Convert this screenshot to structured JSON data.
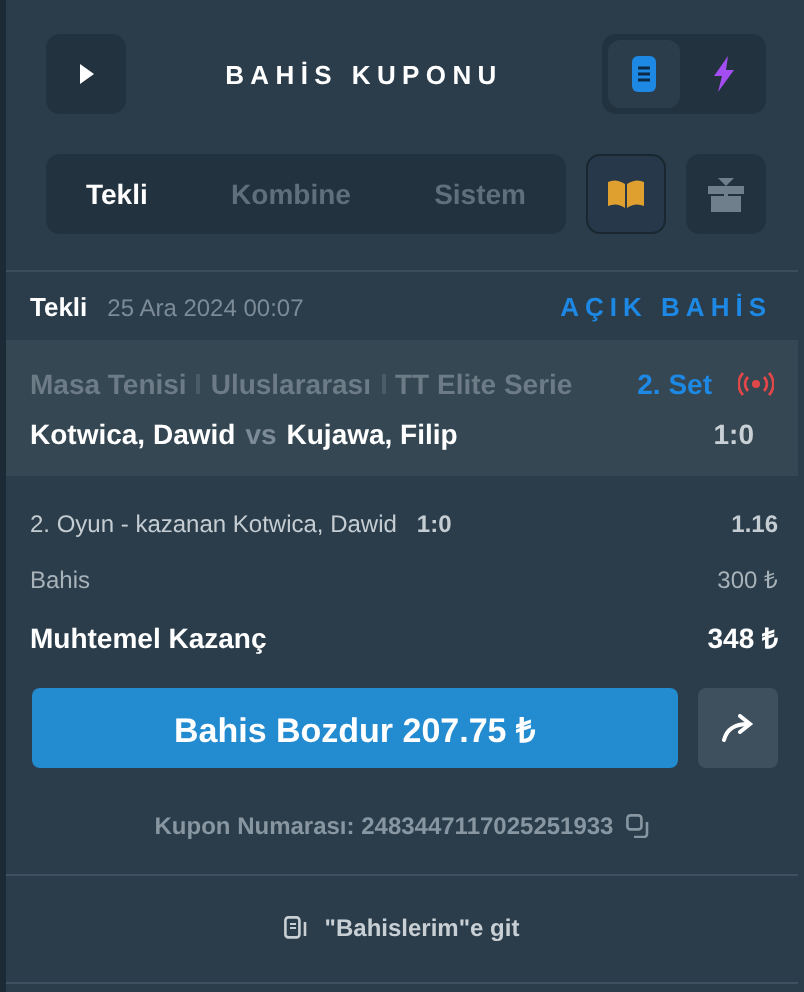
{
  "title": "BAHİS KUPONU",
  "modes": [
    {
      "kind": "document",
      "selected": true
    },
    {
      "kind": "bolt",
      "selected": false
    }
  ],
  "tabs": [
    {
      "label": "Tekli",
      "selected": true
    },
    {
      "label": "Kombine",
      "selected": false
    },
    {
      "label": "Sistem",
      "selected": false
    }
  ],
  "tools": [
    {
      "kind": "book",
      "selected": true
    },
    {
      "kind": "gift",
      "selected": false
    }
  ],
  "ticket": {
    "type": "Tekli",
    "date": "25 Ara 2024 00:07",
    "status": "AÇIK BAHİS",
    "breadcrumb": [
      "Masa Tenisi",
      "Uluslararası",
      "TT Elite Serie"
    ],
    "period": "2. Set",
    "live": true,
    "home": "Kotwica, Dawid",
    "vs": "vs",
    "away": "Kujawa, Filip",
    "score": "1:0",
    "selection": "2. Oyun - kazanan Kotwica, Dawid",
    "selection_score": "1:0",
    "odds": "1.16",
    "stake_label": "Bahis",
    "stake": "300 ₺",
    "win_label": "Muhtemel Kazanç",
    "win": "348 ₺",
    "cashout": "Bahis Bozdur 207.75 ₺",
    "coupon": "Kupon Numarası: 2483447117025251933"
  },
  "footer_link": "\"Bahislerim\"e git"
}
